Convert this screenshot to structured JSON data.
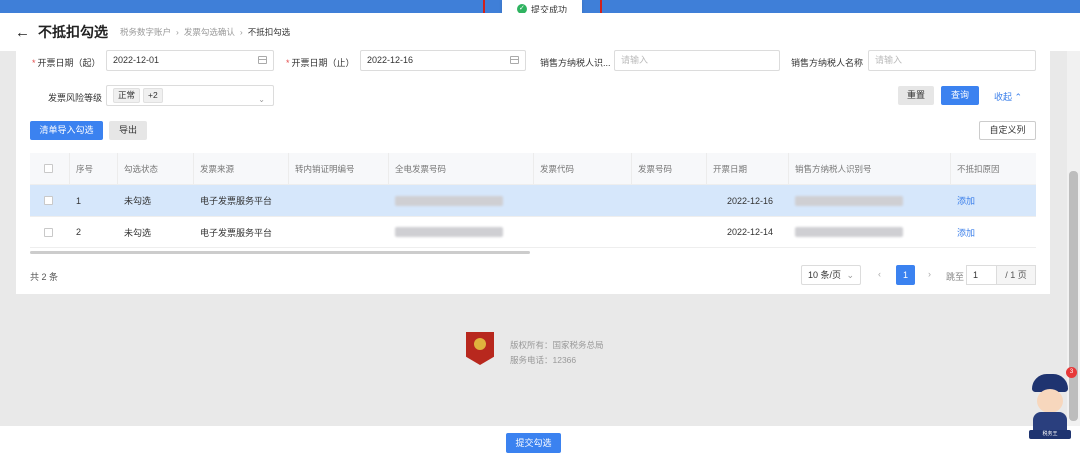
{
  "toast": {
    "text": "提交成功"
  },
  "header": {
    "back_icon": "arrow-left-icon",
    "title": "不抵扣勾选",
    "breadcrumb": [
      "税务数字账户",
      "发票勾选确认",
      "不抵扣勾选"
    ]
  },
  "filters": {
    "start_date": {
      "label": "开票日期（起）",
      "value": "2022-12-01"
    },
    "end_date": {
      "label": "开票日期（止）",
      "value": "2022-12-16"
    },
    "seller_tax_id": {
      "label": "销售方纳税人识...",
      "placeholder": "请输入"
    },
    "seller_name": {
      "label": "销售方纳税人名称",
      "placeholder": "请输入"
    },
    "risk_level": {
      "label": "发票风险等级",
      "tags": [
        "正常",
        "+2"
      ]
    },
    "reset_label": "重置",
    "query_label": "查询",
    "collapse_label": "收起"
  },
  "actions": {
    "import_label": "清单导入勾选",
    "export_label": "导出",
    "custom_columns_label": "自定义列"
  },
  "table": {
    "columns": [
      "序号",
      "勾选状态",
      "发票来源",
      "转内销证明编号",
      "全电发票号码",
      "发票代码",
      "发票号码",
      "开票日期",
      "销售方纳税人识别号",
      "不抵扣原因"
    ],
    "rows": [
      {
        "index": "1",
        "status": "未勾选",
        "source": "电子发票服务平台",
        "date": "2022-12-16",
        "action": "添加"
      },
      {
        "index": "2",
        "status": "未勾选",
        "source": "电子发票服务平台",
        "date": "2022-12-14",
        "action": "添加"
      }
    ]
  },
  "pagination": {
    "total": "共 2 条",
    "page_size": "10 条/页",
    "current_page": "1",
    "jump_label": "跳至",
    "jump_value": "1",
    "total_pages": "/ 1 页"
  },
  "footer": {
    "copyright": "版权所有：国家税务总局",
    "phone": "服务电话：12366"
  },
  "submit_label": "提交勾选",
  "mascot": {
    "badge": "3",
    "caption": "税务王"
  },
  "colors": {
    "primary": "#3b82f0",
    "topbar": "#3f7fd8",
    "selected_row": "#d6e7fb",
    "highlight_border": "#d0211d"
  }
}
